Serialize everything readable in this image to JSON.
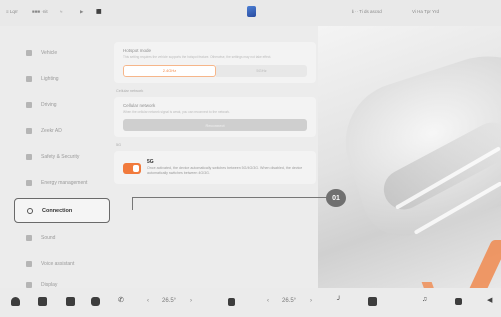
{
  "status_bar": {
    "left_items": [
      "≡ Lqrr",
      "■■■ ·nit",
      "≈",
      "▶",
      "⬛"
    ],
    "center_logo": "brand-logo",
    "right_text_1": "ℹ  ·· Ti ds ascsd",
    "right_text_2": "Vi Ha Tpr Yrd"
  },
  "sidebar": {
    "items": [
      {
        "label": "Vehicle",
        "icon": "car-icon"
      },
      {
        "label": "Lighting",
        "icon": "light-icon"
      },
      {
        "label": "Driving",
        "icon": "steering-icon"
      },
      {
        "label": "Zeekr AD",
        "icon": "ad-icon"
      },
      {
        "label": "Safety & Security",
        "icon": "shield-icon"
      },
      {
        "label": "Energy management",
        "icon": "energy-icon"
      },
      {
        "label": "Connection",
        "icon": "link-icon",
        "active": true
      },
      {
        "label": "Sound",
        "icon": "sound-icon"
      },
      {
        "label": "Voice assistant",
        "icon": "voice-icon"
      },
      {
        "label": "Display",
        "icon": "display-icon"
      }
    ]
  },
  "main": {
    "hotspot_card": {
      "title": "Hotspot mode",
      "desc": "This setting requires the vehicle supports the hotspot feature. Otherwise, the settings may not take effect.",
      "option_on": "2.4GHz",
      "option_off": "5GHz"
    },
    "cellular_section_label": "Cellular network",
    "cellular_card": {
      "title": "Cellular network",
      "desc": "When the cellular network signal is weak, you can reconnect to the network.",
      "button": "Reconnect"
    },
    "fiveg_section_label": "5G",
    "fiveg": {
      "title": "5G",
      "desc": "Once activated, the device automatically switches between 5G/4G/3G. When disabled, the device automatically switches between 4G/3G.",
      "enabled": true
    }
  },
  "callout": {
    "label": "01"
  },
  "dock": {
    "temp_left": "26.5°",
    "temp_right": "26.5°",
    "arrow_left": "‹",
    "arrow_right": "›"
  },
  "colors": {
    "accent": "#f17a3c",
    "active_border": "#6a6a6a"
  }
}
